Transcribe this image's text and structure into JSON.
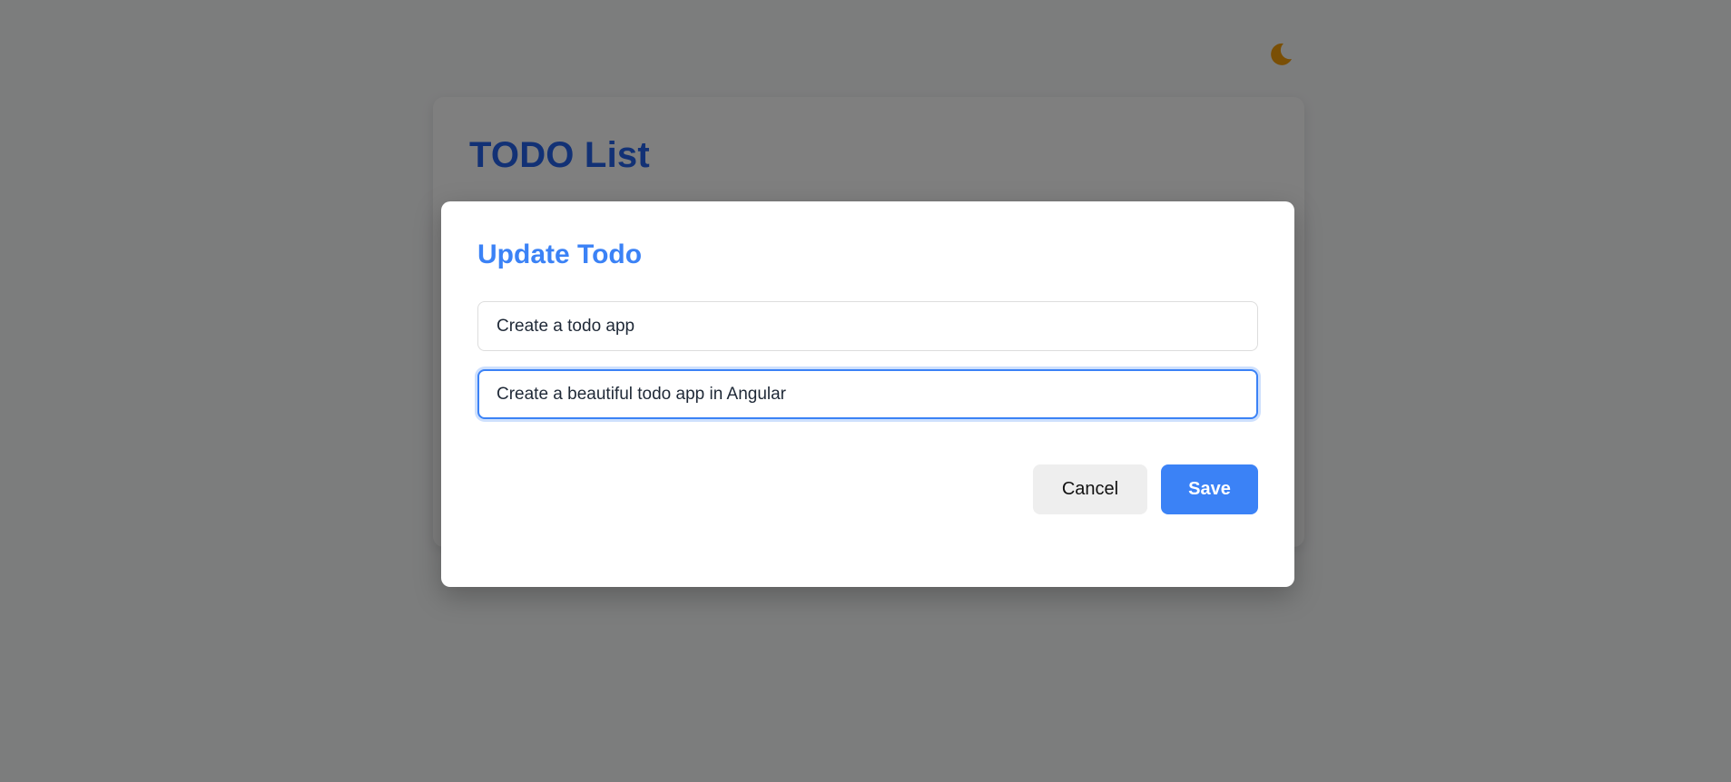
{
  "page": {
    "title": "TODO List",
    "theme_toggle_icon": "moon-icon",
    "colors": {
      "title": "#2563eb",
      "moon": "#f59e0b"
    }
  },
  "modal": {
    "title": "Update Todo",
    "title_field": {
      "value": "Create a todo app"
    },
    "description_field": {
      "value": "Create a beautiful todo app in Angular",
      "focused": true
    },
    "cancel_label": "Cancel",
    "save_label": "Save",
    "colors": {
      "accent": "#3b82f6",
      "cancel_bg": "#eeeeee",
      "overlay": "rgba(0,0,0,0.5)"
    }
  }
}
